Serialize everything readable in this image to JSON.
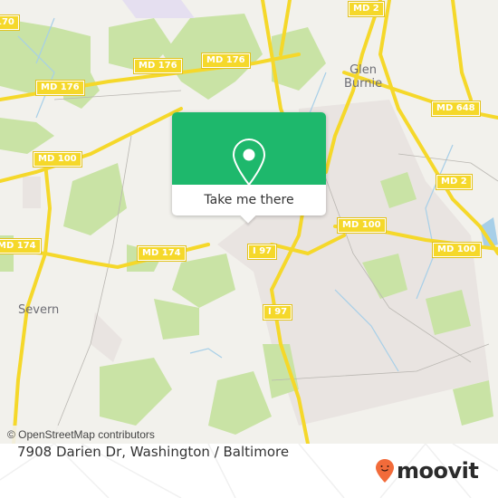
{
  "map": {
    "roads": [
      {
        "label": "MD 2",
        "type": "state-route"
      },
      {
        "label": "MD 176",
        "type": "state-route"
      },
      {
        "label": "MD 176",
        "type": "state-route"
      },
      {
        "label": "MD 176",
        "type": "state-route"
      },
      {
        "label": "MD 100",
        "type": "state-route"
      },
      {
        "label": "MD 100",
        "type": "state-route"
      },
      {
        "label": "MD 100",
        "type": "state-route"
      },
      {
        "label": "MD 174",
        "type": "state-route"
      },
      {
        "label": "MD 174",
        "type": "state-route"
      },
      {
        "label": "MD 648",
        "type": "state-route"
      },
      {
        "label": "MD 2",
        "type": "state-route"
      },
      {
        "label": "I 97",
        "type": "interstate"
      },
      {
        "label": "I 97",
        "type": "interstate"
      },
      {
        "label": "170",
        "type": "state-route"
      }
    ],
    "places": [
      {
        "name": "Glen\nBurnie",
        "line1": "Glen",
        "line2": "Burnie"
      },
      {
        "name": "Severn"
      }
    ],
    "colors": {
      "background": "#f2f1ec",
      "park": "#c9e3a5",
      "road": "#f5d82a",
      "water": "#a7cfe8",
      "urban": "#e9e4e1"
    },
    "attribution": "© OpenStreetMap contributors"
  },
  "popup": {
    "icon": "map-pin-icon",
    "button_label": "Take me there",
    "color": "#1eb86c"
  },
  "footer": {
    "address": "7908 Darien Dr, Washington / Baltimore",
    "brand": "moovit",
    "brand_color": "#f26b3a"
  }
}
